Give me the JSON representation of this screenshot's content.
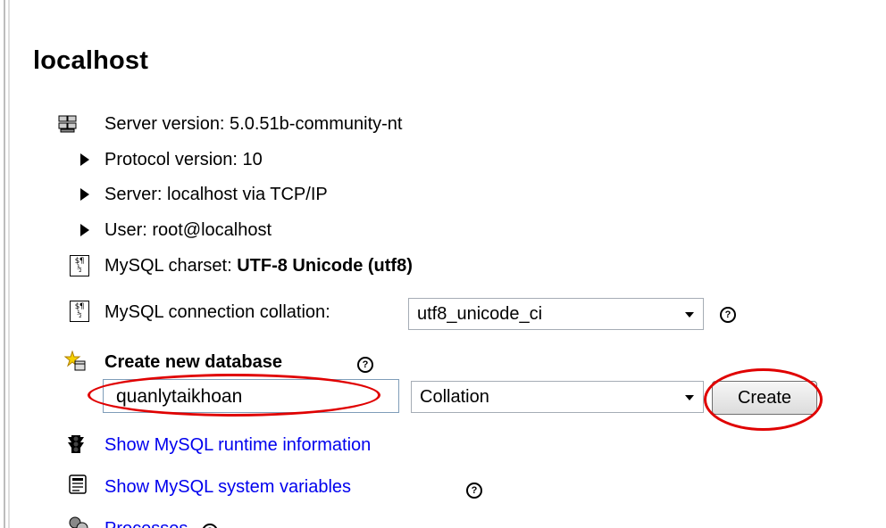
{
  "server": {
    "title": "localhost",
    "server_version": "Server version: 5.0.51b-community-nt",
    "protocol_version": "Protocol version: 10",
    "server_info": "Server: localhost via TCP/IP",
    "user": "User: root@localhost",
    "charset_label": "MySQL charset: ",
    "charset_value": "UTF-8 Unicode (utf8)",
    "collation_label": "MySQL connection collation:",
    "collation_value": "utf8_unicode_ci"
  },
  "create_db": {
    "heading": "Create new database",
    "db_name_value": "quanlytaikhoan",
    "collation_select": "Collation",
    "create_button": "Create"
  },
  "links": {
    "runtime_info": "Show MySQL runtime information",
    "system_variables": "Show MySQL system variables",
    "processes": "Processes"
  },
  "help_glyph": "?",
  "icons": [
    "server-icon",
    "charset-icon",
    "new-database-icon",
    "traffic-light-icon",
    "variables-icon",
    "processes-icon",
    "help-icon"
  ],
  "colors": {
    "link": "#0000ee",
    "highlight_ellipse": "#e00000"
  }
}
